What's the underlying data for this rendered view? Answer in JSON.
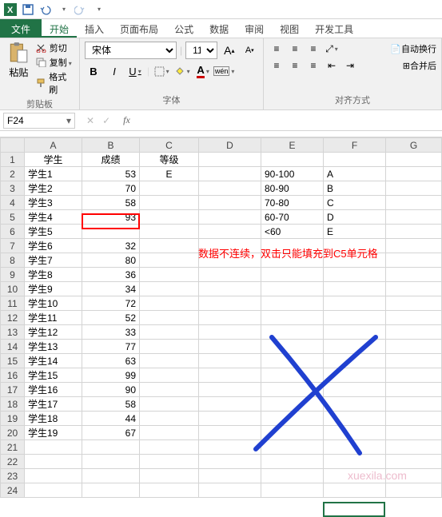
{
  "qat": {
    "excel_icon": "X"
  },
  "tabs": {
    "file": "文件",
    "home": "开始",
    "insert": "插入",
    "page_layout": "页面布局",
    "formulas": "公式",
    "data": "数据",
    "review": "审阅",
    "view": "视图",
    "developer": "开发工具"
  },
  "ribbon": {
    "clipboard": {
      "paste": "粘贴",
      "cut": "剪切",
      "copy": "复制",
      "format_painter": "格式刷",
      "label": "剪贴板"
    },
    "font": {
      "name": "宋体",
      "size": "11",
      "bold": "B",
      "italic": "I",
      "underline": "U",
      "increase": "A",
      "decrease": "A",
      "phonetic": "wén",
      "label": "字体"
    },
    "alignment": {
      "wrap": "自动换行",
      "merge": "合并后",
      "label": "对齐方式"
    }
  },
  "namebox": "F24",
  "fx": "fx",
  "columns": [
    "A",
    "B",
    "C",
    "D",
    "E",
    "F",
    "G"
  ],
  "rows": [
    {
      "n": "1",
      "A": "学生",
      "B": "成绩",
      "C": "等级"
    },
    {
      "n": "2",
      "A": "学生1",
      "B": "53",
      "C": "E",
      "E": "90-100",
      "F": "A"
    },
    {
      "n": "3",
      "A": "学生2",
      "B": "70",
      "E": "80-90",
      "F": "B"
    },
    {
      "n": "4",
      "A": "学生3",
      "B": "58",
      "E": "70-80",
      "F": "C"
    },
    {
      "n": "5",
      "A": "学生4",
      "B": "93",
      "E": "60-70",
      "F": "D"
    },
    {
      "n": "6",
      "A": "学生5",
      "E": "<60",
      "F": "E"
    },
    {
      "n": "7",
      "A": "学生6",
      "B": "32"
    },
    {
      "n": "8",
      "A": "学生7",
      "B": "80"
    },
    {
      "n": "9",
      "A": "学生8",
      "B": "36"
    },
    {
      "n": "10",
      "A": "学生9",
      "B": "34"
    },
    {
      "n": "11",
      "A": "学生10",
      "B": "72"
    },
    {
      "n": "12",
      "A": "学生11",
      "B": "52"
    },
    {
      "n": "13",
      "A": "学生12",
      "B": "33"
    },
    {
      "n": "14",
      "A": "学生13",
      "B": "77"
    },
    {
      "n": "15",
      "A": "学生14",
      "B": "63"
    },
    {
      "n": "16",
      "A": "学生15",
      "B": "99"
    },
    {
      "n": "17",
      "A": "学生16",
      "B": "90"
    },
    {
      "n": "18",
      "A": "学生17",
      "B": "58"
    },
    {
      "n": "19",
      "A": "学生18",
      "B": "44"
    },
    {
      "n": "20",
      "A": "学生19",
      "B": "67"
    },
    {
      "n": "21"
    },
    {
      "n": "22"
    },
    {
      "n": "23"
    },
    {
      "n": "24"
    }
  ],
  "note": "数据不连续，双击只能填充到C5单元格",
  "watermark": "xuexila.com"
}
